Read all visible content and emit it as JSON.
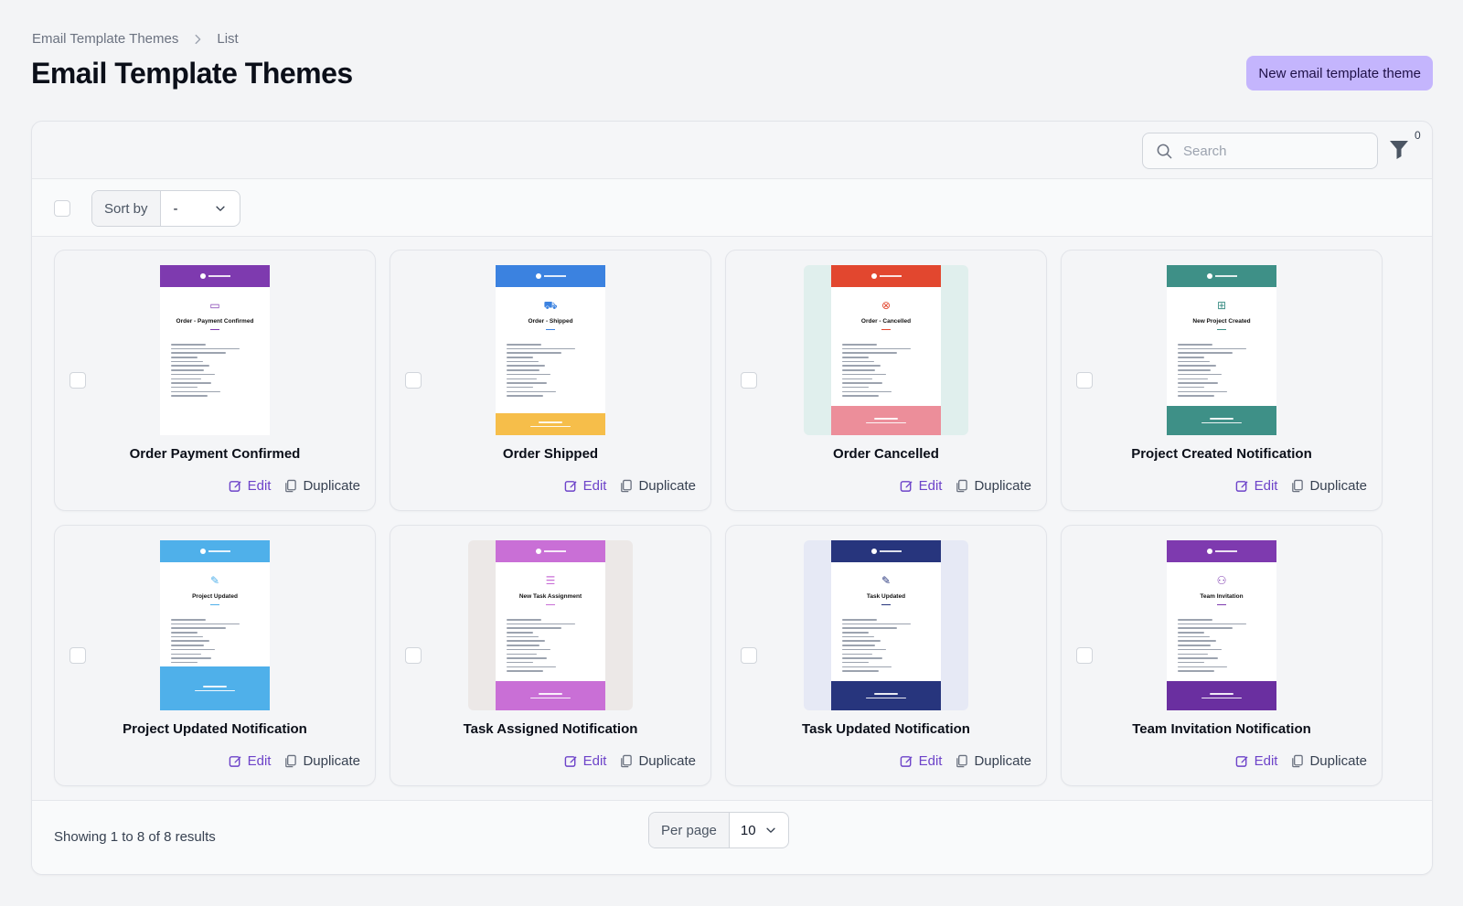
{
  "breadcrumb": {
    "parent": "Email Template Themes",
    "current": "List"
  },
  "page": {
    "title": "Email Template Themes",
    "new_button": "New email template theme"
  },
  "toolbar": {
    "search_placeholder": "Search",
    "filter_count": "0"
  },
  "sort": {
    "label": "Sort by",
    "value": "-"
  },
  "cards": [
    {
      "name": "Order Payment Confirmed",
      "email_title": "Order - Payment Confirmed",
      "accent": "#7e3aaf",
      "footer": "",
      "backdrop": "#f4f5f7",
      "icon": "card-icon"
    },
    {
      "name": "Order Shipped",
      "email_title": "Order - Shipped",
      "accent": "#3b82e0",
      "footer": "#f6be4a",
      "backdrop": "#f4f5f7",
      "icon": "truck-icon"
    },
    {
      "name": "Order Cancelled",
      "email_title": "Order - Cancelled",
      "accent": "#e2472f",
      "footer": "#ec8e9a",
      "backdrop": "#e0efed",
      "icon": "cancel-icon"
    },
    {
      "name": "Project Created Notification",
      "email_title": "New Project Created",
      "accent": "#3e9087",
      "footer": "#3e9087",
      "backdrop": "#f4f5f7",
      "icon": "plus-icon"
    },
    {
      "name": "Project Updated Notification",
      "email_title": "Project Updated",
      "accent": "#4fb0ea",
      "footer": "#4fb0ea",
      "backdrop": "#f4f5f7",
      "icon": "edit-icon"
    },
    {
      "name": "Task Assigned Notification",
      "email_title": "New Task Assignment",
      "accent": "#c96fd6",
      "footer": "#c96fd6",
      "backdrop": "#ece8e7",
      "icon": "list-icon"
    },
    {
      "name": "Task Updated Notification",
      "email_title": "Task Updated",
      "accent": "#27357d",
      "footer": "#27357d",
      "backdrop": "#e6e9f5",
      "icon": "edit-icon"
    },
    {
      "name": "Team Invitation Notification",
      "email_title": "Team Invitation",
      "accent": "#7e3aaf",
      "footer": "#6a2fa0",
      "backdrop": "#f4f5f7",
      "icon": "user-plus-icon"
    }
  ],
  "actions": {
    "edit": "Edit",
    "duplicate": "Duplicate"
  },
  "footer": {
    "showing": "Showing 1 to 8 of 8 results",
    "per_page_label": "Per page",
    "per_page_value": "10"
  }
}
